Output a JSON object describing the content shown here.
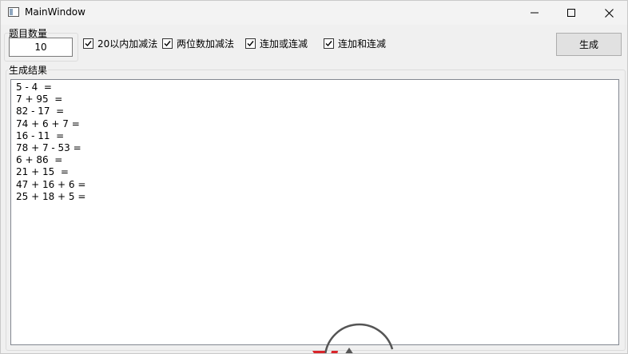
{
  "window": {
    "title": "MainWindow",
    "icon": "app-window-icon"
  },
  "controls": {
    "count_label": "题目数量",
    "count_value": "10",
    "checkboxes": [
      {
        "label": "20以内加减法",
        "checked": true
      },
      {
        "label": "两位数加减法",
        "checked": true
      },
      {
        "label": "连加或连减",
        "checked": true
      },
      {
        "label": "连加和连减",
        "checked": true
      }
    ],
    "generate_label": "生成"
  },
  "result": {
    "label": "生成结果",
    "lines": [
      "5 - 4  =",
      "7 + 95  =",
      "82 - 17  =",
      "74 + 6 + 7 =",
      "16 - 11  =",
      "78 + 7 - 53 =",
      "6 + 86  =",
      "21 + 15  =",
      "47 + 16 + 6 =",
      "25 + 18 + 5 ="
    ]
  },
  "colors": {
    "watermark_red": "#d9242a",
    "watermark_gray": "#555555"
  }
}
